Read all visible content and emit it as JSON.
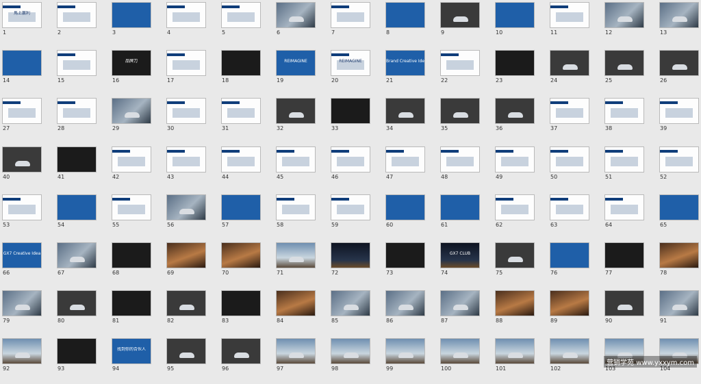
{
  "slides": [
    {
      "n": "1",
      "s": "white",
      "t": "馬上赢利"
    },
    {
      "n": "2",
      "s": "white",
      "t": ""
    },
    {
      "n": "3",
      "s": "blue",
      "t": ""
    },
    {
      "n": "4",
      "s": "white",
      "t": ""
    },
    {
      "n": "5",
      "s": "white",
      "t": ""
    },
    {
      "n": "6",
      "s": "photo",
      "t": ""
    },
    {
      "n": "7",
      "s": "white",
      "t": ""
    },
    {
      "n": "8",
      "s": "blue",
      "t": ""
    },
    {
      "n": "9",
      "s": "gray",
      "t": ""
    },
    {
      "n": "10",
      "s": "blue",
      "t": ""
    },
    {
      "n": "11",
      "s": "white",
      "t": ""
    },
    {
      "n": "12",
      "s": "photo",
      "t": ""
    },
    {
      "n": "13",
      "s": "photo",
      "t": ""
    },
    {
      "n": "14",
      "s": "blue",
      "t": ""
    },
    {
      "n": "15",
      "s": "white",
      "t": ""
    },
    {
      "n": "16",
      "s": "dark",
      "t": "品牌刀"
    },
    {
      "n": "17",
      "s": "white",
      "t": ""
    },
    {
      "n": "18",
      "s": "dark",
      "t": ""
    },
    {
      "n": "19",
      "s": "blue",
      "t": "REIMAGINE"
    },
    {
      "n": "20",
      "s": "white",
      "t": "REIMAGINE"
    },
    {
      "n": "21",
      "s": "blue",
      "t": "Brand Creative Idea"
    },
    {
      "n": "22",
      "s": "white",
      "t": ""
    },
    {
      "n": "23",
      "s": "dark",
      "t": ""
    },
    {
      "n": "24",
      "s": "gray",
      "t": ""
    },
    {
      "n": "25",
      "s": "gray",
      "t": ""
    },
    {
      "n": "26",
      "s": "gray",
      "t": ""
    },
    {
      "n": "27",
      "s": "white",
      "t": ""
    },
    {
      "n": "28",
      "s": "white",
      "t": ""
    },
    {
      "n": "29",
      "s": "photo",
      "t": ""
    },
    {
      "n": "30",
      "s": "white",
      "t": ""
    },
    {
      "n": "31",
      "s": "white",
      "t": ""
    },
    {
      "n": "32",
      "s": "gray",
      "t": ""
    },
    {
      "n": "33",
      "s": "dark",
      "t": ""
    },
    {
      "n": "34",
      "s": "gray",
      "t": ""
    },
    {
      "n": "35",
      "s": "gray",
      "t": ""
    },
    {
      "n": "36",
      "s": "gray",
      "t": ""
    },
    {
      "n": "37",
      "s": "white",
      "t": ""
    },
    {
      "n": "38",
      "s": "white",
      "t": ""
    },
    {
      "n": "39",
      "s": "white",
      "t": ""
    },
    {
      "n": "40",
      "s": "gray",
      "t": ""
    },
    {
      "n": "41",
      "s": "dark",
      "t": ""
    },
    {
      "n": "42",
      "s": "white",
      "t": ""
    },
    {
      "n": "43",
      "s": "white",
      "t": ""
    },
    {
      "n": "44",
      "s": "white",
      "t": ""
    },
    {
      "n": "45",
      "s": "white",
      "t": ""
    },
    {
      "n": "46",
      "s": "white",
      "t": ""
    },
    {
      "n": "47",
      "s": "white",
      "t": ""
    },
    {
      "n": "48",
      "s": "white",
      "t": ""
    },
    {
      "n": "49",
      "s": "white",
      "t": ""
    },
    {
      "n": "50",
      "s": "white",
      "t": ""
    },
    {
      "n": "51",
      "s": "white",
      "t": ""
    },
    {
      "n": "52",
      "s": "white",
      "t": ""
    },
    {
      "n": "53",
      "s": "white",
      "t": ""
    },
    {
      "n": "54",
      "s": "blue",
      "t": ""
    },
    {
      "n": "55",
      "s": "white",
      "t": ""
    },
    {
      "n": "56",
      "s": "photo",
      "t": ""
    },
    {
      "n": "57",
      "s": "blue",
      "t": ""
    },
    {
      "n": "58",
      "s": "white",
      "t": ""
    },
    {
      "n": "59",
      "s": "white",
      "t": ""
    },
    {
      "n": "60",
      "s": "blue",
      "t": ""
    },
    {
      "n": "61",
      "s": "blue",
      "t": ""
    },
    {
      "n": "62",
      "s": "white",
      "t": ""
    },
    {
      "n": "63",
      "s": "white",
      "t": ""
    },
    {
      "n": "64",
      "s": "white",
      "t": ""
    },
    {
      "n": "65",
      "s": "blue",
      "t": ""
    },
    {
      "n": "66",
      "s": "blue",
      "t": "GX7 Creative Idea"
    },
    {
      "n": "67",
      "s": "photo",
      "t": ""
    },
    {
      "n": "68",
      "s": "dark",
      "t": ""
    },
    {
      "n": "69",
      "s": "warm",
      "t": ""
    },
    {
      "n": "70",
      "s": "warm",
      "t": ""
    },
    {
      "n": "71",
      "s": "sky",
      "t": ""
    },
    {
      "n": "72",
      "s": "night",
      "t": ""
    },
    {
      "n": "73",
      "s": "dark",
      "t": ""
    },
    {
      "n": "74",
      "s": "night",
      "t": "GX7 CLUB"
    },
    {
      "n": "75",
      "s": "gray",
      "t": ""
    },
    {
      "n": "76",
      "s": "blue",
      "t": ""
    },
    {
      "n": "77",
      "s": "dark",
      "t": ""
    },
    {
      "n": "78",
      "s": "warm",
      "t": ""
    },
    {
      "n": "79",
      "s": "photo",
      "t": ""
    },
    {
      "n": "80",
      "s": "gray",
      "t": ""
    },
    {
      "n": "81",
      "s": "dark",
      "t": ""
    },
    {
      "n": "82",
      "s": "gray",
      "t": ""
    },
    {
      "n": "83",
      "s": "dark",
      "t": ""
    },
    {
      "n": "84",
      "s": "warm",
      "t": ""
    },
    {
      "n": "85",
      "s": "photo",
      "t": ""
    },
    {
      "n": "86",
      "s": "photo",
      "t": ""
    },
    {
      "n": "87",
      "s": "photo",
      "t": ""
    },
    {
      "n": "88",
      "s": "warm",
      "t": ""
    },
    {
      "n": "89",
      "s": "warm",
      "t": ""
    },
    {
      "n": "90",
      "s": "gray",
      "t": ""
    },
    {
      "n": "91",
      "s": "photo",
      "t": ""
    },
    {
      "n": "92",
      "s": "sky",
      "t": ""
    },
    {
      "n": "93",
      "s": "dark",
      "t": ""
    },
    {
      "n": "94",
      "s": "blue",
      "t": "找到你的合伙人"
    },
    {
      "n": "95",
      "s": "gray",
      "t": ""
    },
    {
      "n": "96",
      "s": "gray",
      "t": ""
    },
    {
      "n": "97",
      "s": "sky",
      "t": ""
    },
    {
      "n": "98",
      "s": "sky",
      "t": ""
    },
    {
      "n": "99",
      "s": "sky",
      "t": ""
    },
    {
      "n": "100",
      "s": "sky",
      "t": ""
    },
    {
      "n": "101",
      "s": "sky",
      "t": ""
    },
    {
      "n": "102",
      "s": "sky",
      "t": ""
    },
    {
      "n": "103",
      "s": "sky",
      "t": ""
    },
    {
      "n": "104",
      "s": "sky",
      "t": ""
    }
  ],
  "watermark": "营销学苑 www.yxxym.com"
}
